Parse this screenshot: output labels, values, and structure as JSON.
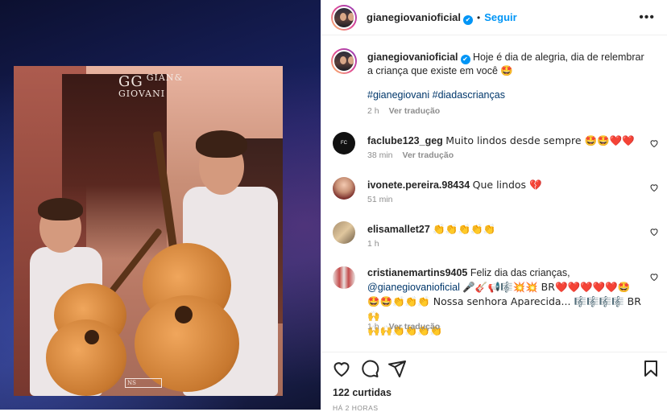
{
  "header": {
    "username": "gianegiovanioficial",
    "follow_label": "Seguir",
    "more_label": "•••"
  },
  "photo": {
    "watermark_logo": "GG",
    "watermark_line1": "GIAN&",
    "watermark_line2": "GIOVANI",
    "corner_logo": "NS"
  },
  "caption": {
    "username": "gianegiovanioficial",
    "text": "Hoje é dia de alegria, dia de relembrar a criança que existe em você 🤩",
    "hashtags": "#gianegiovani #diadascrianças",
    "time": "2 h",
    "translate": "Ver tradução"
  },
  "comments": [
    {
      "user": "faclube123_geg",
      "text": "Muito lindos desde sempre 🤩🤩❤️❤️",
      "time": "38 min",
      "translate": "Ver tradução"
    },
    {
      "user": "ivonete.pereira.98434",
      "text": "Que lindos 💔",
      "time": "51 min",
      "translate": ""
    },
    {
      "user": "elisamallet27",
      "text": "👏👏👏👏👏",
      "time": "1 h",
      "translate": ""
    },
    {
      "user": "cristianemartins9405",
      "text": "Feliz dia das crianças,",
      "mention": "@gianegiovanioficial",
      "text2": "🎤🎸📢🎼💥💥 BR❤️❤️❤️❤️❤️🤩",
      "text3": "🤩🤩👏👏👏 Nossa senhora Aparecida... 🎼🎼🎼🎼 BR🙌",
      "text4": "🙌🙌👏👏👏👏",
      "time": "1 h",
      "translate": "Ver tradução"
    }
  ],
  "footer": {
    "likes": "122 curtidas",
    "ago": "HÁ 2 HORAS"
  },
  "colors": {
    "accent": "#0095f6",
    "text": "#262626",
    "muted": "#8e8e8e",
    "link": "#00376b"
  },
  "icons": [
    "more-icon",
    "verified-icon",
    "heart-icon",
    "comment-icon",
    "share-icon",
    "bookmark-icon"
  ]
}
